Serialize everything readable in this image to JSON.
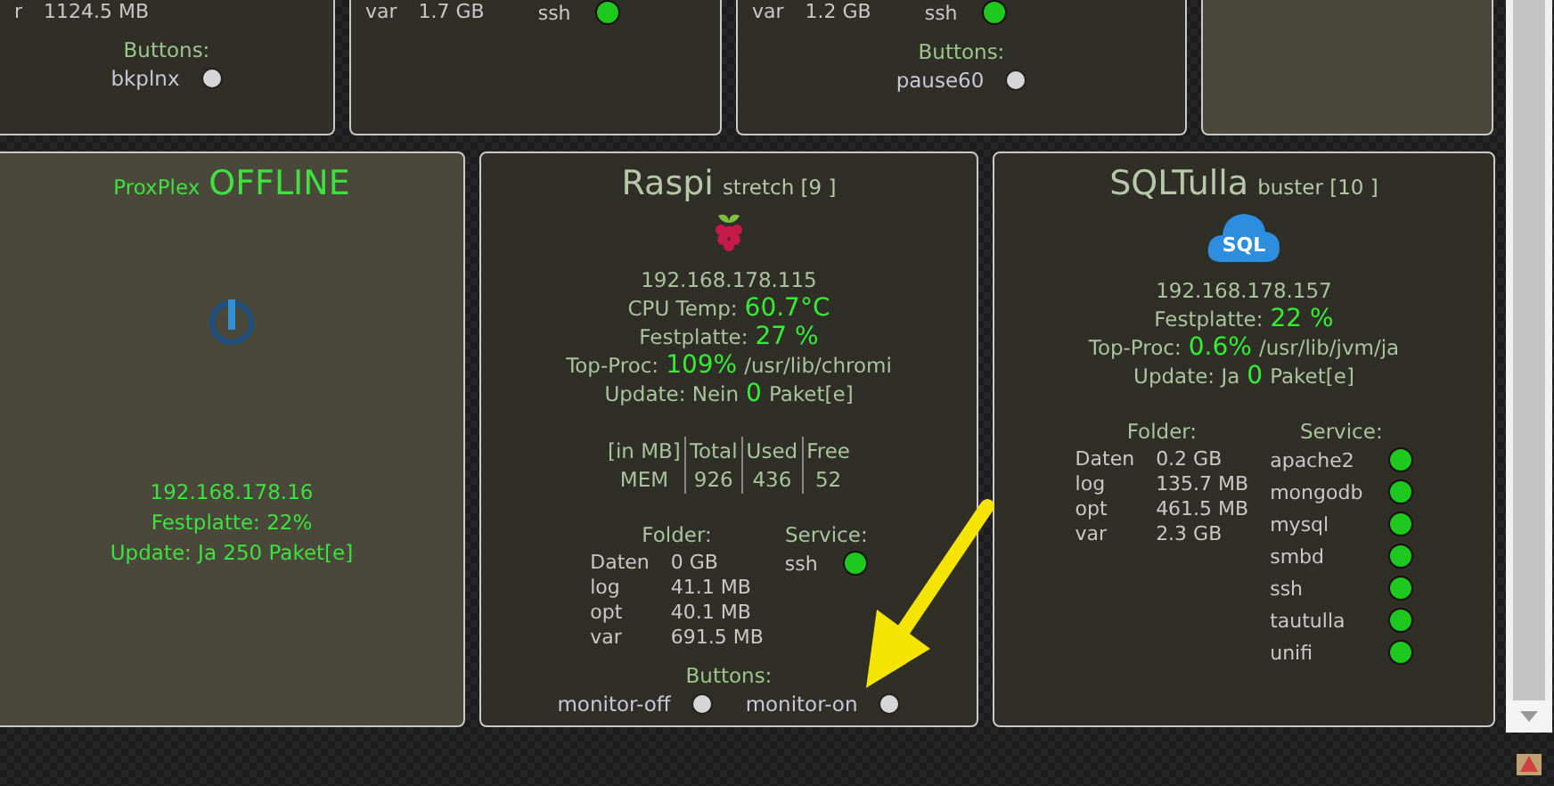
{
  "top_cards": [
    {
      "kind": "online",
      "folders": [
        {
          "name": "r",
          "value": "1124.5 MB"
        }
      ],
      "buttons_title": "Buttons:",
      "buttons": [
        {
          "label": "bkplnx"
        }
      ]
    },
    {
      "kind": "online",
      "folders": [
        {
          "name": "var",
          "value": "1.7 GB"
        }
      ],
      "services": [
        {
          "name": "ssh",
          "running": true
        }
      ]
    },
    {
      "kind": "online",
      "folders": [
        {
          "name": "var",
          "value": "1.2 GB"
        }
      ],
      "services": [
        {
          "name": "ssh",
          "running": true
        }
      ],
      "buttons_title": "Buttons:",
      "buttons": [
        {
          "label": "pause60"
        }
      ]
    },
    {
      "kind": "offline"
    }
  ],
  "cards": [
    {
      "kind": "offline",
      "title": [
        {
          "text": "ProxPlex"
        },
        {
          "text": "OFFLINE"
        }
      ],
      "lines": [
        [
          {
            "text": "192.168.178.16",
            "highlight": false
          }
        ],
        [
          {
            "text": "Festplatte: 22%",
            "highlight": false
          }
        ],
        [
          {
            "text": "Update: Ja 250 Paket[e]",
            "highlight": false
          }
        ]
      ]
    },
    {
      "kind": "pi",
      "title": [
        {
          "text": "Raspi"
        },
        {
          "text": "stretch [9 ]"
        }
      ],
      "lines": [
        [
          {
            "text": "192.168.178.115",
            "highlight": false
          }
        ],
        [
          {
            "text": "CPU Temp:",
            "highlight": false
          },
          {
            "text": "60.7°C",
            "highlight": true
          }
        ],
        [
          {
            "text": "Festplatte:",
            "highlight": false
          },
          {
            "text": "27 %",
            "highlight": true
          }
        ],
        [
          {
            "text": "Top-Proc:",
            "highlight": false
          },
          {
            "text": "109%",
            "highlight": true
          },
          {
            "text": "/usr/lib/chromi",
            "highlight": false
          }
        ],
        [
          {
            "text": "Update: Nein",
            "highlight": false
          },
          {
            "text": "0",
            "highlight": true
          },
          {
            "text": "Paket[e]",
            "highlight": false
          }
        ]
      ],
      "mem_table": {
        "columns": [
          "[in MB]",
          "Total",
          "Used",
          "Free"
        ],
        "rows": [
          [
            "MEM",
            "926",
            "436",
            "52"
          ]
        ]
      },
      "folders_title": "Folder:",
      "folders": [
        {
          "name": "Daten",
          "value": "0 GB"
        },
        {
          "name": "log",
          "value": "41.1 MB"
        },
        {
          "name": "opt",
          "value": "40.1 MB"
        },
        {
          "name": "var",
          "value": "691.5 MB"
        }
      ],
      "services_title": "Service:",
      "services": [
        {
          "name": "ssh",
          "running": true
        }
      ],
      "buttons_title": "Buttons:",
      "buttons": [
        {
          "label": "monitor-off"
        },
        {
          "label": "monitor-on"
        }
      ]
    },
    {
      "kind": "sql",
      "title": [
        {
          "text": "SQLTulla"
        },
        {
          "text": "buster [10 ]"
        }
      ],
      "icon_text": "SQL",
      "lines": [
        [
          {
            "text": "192.168.178.157",
            "highlight": false
          }
        ],
        [
          {
            "text": "Festplatte:",
            "highlight": false
          },
          {
            "text": "22 %",
            "highlight": true
          }
        ],
        [
          {
            "text": "Top-Proc:",
            "highlight": false
          },
          {
            "text": "0.6%",
            "highlight": true
          },
          {
            "text": "/usr/lib/jvm/ja",
            "highlight": false
          }
        ],
        [
          {
            "text": "Update: Ja",
            "highlight": false
          },
          {
            "text": "0",
            "highlight": true
          },
          {
            "text": "Paket[e]",
            "highlight": false
          }
        ]
      ],
      "folders_title": "Folder:",
      "folders": [
        {
          "name": "Daten",
          "value": "0.2 GB"
        },
        {
          "name": "log",
          "value": "135.7 MB"
        },
        {
          "name": "opt",
          "value": "461.5 MB"
        },
        {
          "name": "var",
          "value": "2.3 GB"
        }
      ],
      "services_title": "Service:",
      "services": [
        {
          "name": "apache2",
          "running": true
        },
        {
          "name": "mongodb",
          "running": true
        },
        {
          "name": "mysql",
          "running": true
        },
        {
          "name": "smbd",
          "running": true
        },
        {
          "name": "ssh",
          "running": true
        },
        {
          "name": "tautulla",
          "running": true
        },
        {
          "name": "unifi",
          "running": true
        }
      ]
    }
  ]
}
